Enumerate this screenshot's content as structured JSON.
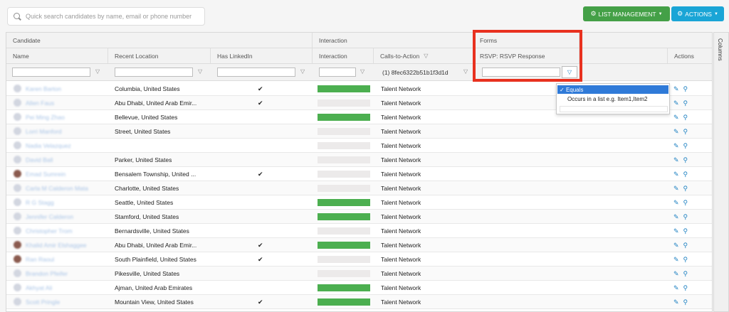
{
  "search": {
    "placeholder": "Quick search candidates by name, email or phone number"
  },
  "toolbar": {
    "list_management": "LIST MANAGEMENT",
    "actions": "ACTIONS",
    "colors": {
      "list_management": "#44a047",
      "actions": "#1aa5d6"
    }
  },
  "grid": {
    "groups": {
      "candidate": "Candidate",
      "interaction": "Interaction",
      "forms": "Forms"
    },
    "columns": {
      "name": "Name",
      "recent_location": "Recent Location",
      "has_linkedin": "Has LinkedIn",
      "interaction": "Interaction",
      "calls_to_action": "Calls-to-Action",
      "rsvp": "RSVP: RSVP Response",
      "actions": "Actions"
    },
    "filters": {
      "cta_value": "(1) 8fec6322b51b1f3d1d"
    },
    "rows": [
      {
        "name": "Karen Barton",
        "avatar": "blank",
        "location": "Columbia, United States",
        "linkedin": true,
        "interaction": 1,
        "cta": "Talent Network"
      },
      {
        "name": "Allen Faus",
        "avatar": "blank",
        "location": "Abu Dhabi, United Arab Emir...",
        "linkedin": true,
        "interaction": 0,
        "cta": "Talent Network"
      },
      {
        "name": "Pei Ming Zhao",
        "avatar": "blank",
        "location": "Bellevue, United States",
        "linkedin": false,
        "interaction": 1,
        "cta": "Talent Network"
      },
      {
        "name": "Lorri Manford",
        "avatar": "blank",
        "location": "Street, United States",
        "linkedin": false,
        "interaction": 0,
        "cta": "Talent Network"
      },
      {
        "name": "Nadia Velazquez",
        "avatar": "blank",
        "location": "",
        "linkedin": false,
        "interaction": 0,
        "cta": "Talent Network"
      },
      {
        "name": "David Ball",
        "avatar": "blank",
        "location": "Parker, United States",
        "linkedin": false,
        "interaction": 0,
        "cta": "Talent Network"
      },
      {
        "name": "Emad Sumrein",
        "avatar": "photo",
        "location": "Bensalem Township, United ...",
        "linkedin": true,
        "interaction": 0,
        "cta": "Talent Network"
      },
      {
        "name": "Carla M Calderon Mata",
        "avatar": "blank",
        "location": "Charlotte, United States",
        "linkedin": false,
        "interaction": 0,
        "cta": "Talent Network"
      },
      {
        "name": "R G Stagg",
        "avatar": "blank",
        "location": "Seattle, United States",
        "linkedin": false,
        "interaction": 1,
        "cta": "Talent Network"
      },
      {
        "name": "Jennifer Calderon",
        "avatar": "blank",
        "location": "Stamford, United States",
        "linkedin": false,
        "interaction": 1,
        "cta": "Talent Network"
      },
      {
        "name": "Christopher Trom",
        "avatar": "blank",
        "location": "Bernardsville, United States",
        "linkedin": false,
        "interaction": 0,
        "cta": "Talent Network"
      },
      {
        "name": "Khalid Amir Elshaggee",
        "avatar": "photo",
        "location": "Abu Dhabi, United Arab Emir...",
        "linkedin": true,
        "interaction": 1,
        "cta": "Talent Network"
      },
      {
        "name": "Ran Raoul",
        "avatar": "photo",
        "location": "South Plainfield, United States",
        "linkedin": true,
        "interaction": 0,
        "cta": "Talent Network"
      },
      {
        "name": "Brandon Pfeifer",
        "avatar": "blank",
        "location": "Pikesville, United States",
        "linkedin": false,
        "interaction": 0,
        "cta": "Talent Network"
      },
      {
        "name": "Akhyat Ali",
        "avatar": "blank",
        "location": "Ajman, United Arab Emirates",
        "linkedin": false,
        "interaction": 1,
        "cta": "Talent Network"
      },
      {
        "name": "Scott Pringle",
        "avatar": "blank",
        "location": "Mountain View, United States",
        "linkedin": true,
        "interaction": 1,
        "cta": "Talent Network"
      }
    ]
  },
  "dropdown": {
    "options": [
      "Equals",
      "Occurs in a list e.g. Item1,Item2"
    ],
    "selected": "Equals"
  },
  "side_tab": "Columns",
  "icons": {
    "filter": "funnel-icon",
    "edit": "pencil-icon",
    "view": "magnifier-icon",
    "check": "checkmark-icon"
  },
  "colors": {
    "highlight": "#e8311f",
    "bar_active": "#4caf50",
    "bar_inactive": "#eceaea",
    "link": "#1a7fc1"
  }
}
